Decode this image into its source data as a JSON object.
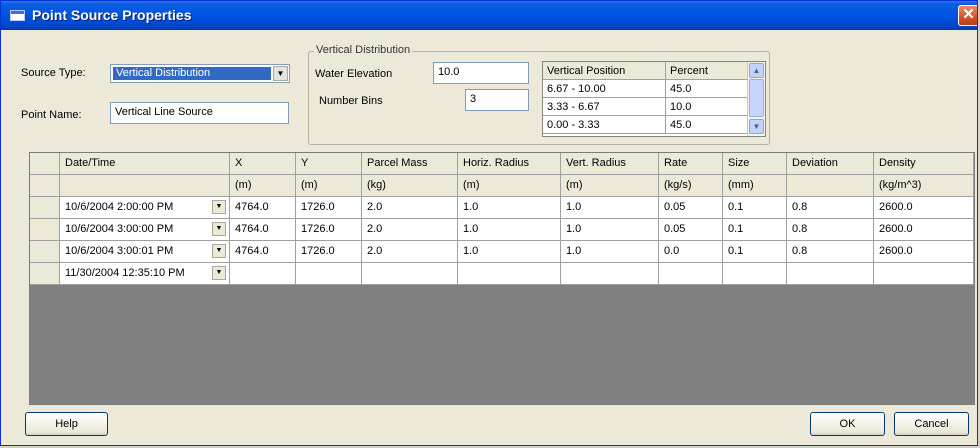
{
  "window": {
    "title": "Point Source Properties",
    "close_glyph": "✕"
  },
  "source_type": {
    "label": "Source Type:",
    "value": "Vertical Distribution"
  },
  "point_name": {
    "label": "Point Name:",
    "value": "Vertical Line Source"
  },
  "vertical_distribution": {
    "group_label": "Vertical Distribution",
    "water_elevation": {
      "label": "Water Elevation",
      "value": "10.0"
    },
    "number_bins": {
      "label": "Number Bins",
      "value": "3"
    },
    "bins_table": {
      "headers": [
        "Vertical Position",
        "Percent"
      ],
      "rows": [
        [
          "6.67 - 10.00",
          "45.0"
        ],
        [
          "3.33 - 6.67",
          "10.0"
        ],
        [
          "0.00 - 3.33",
          "45.0"
        ]
      ]
    }
  },
  "grid": {
    "columns": [
      "Date/Time",
      "X",
      "Y",
      "Parcel Mass",
      "Horiz. Radius",
      "Vert. Radius",
      "Rate",
      "Size",
      "Deviation",
      "Density"
    ],
    "units": [
      "",
      "(m)",
      "(m)",
      "(kg)",
      "(m)",
      "(m)",
      "(kg/s)",
      "(mm)",
      "",
      "(kg/m^3)"
    ],
    "rows": [
      [
        "10/6/2004 2:00:00 PM",
        "4764.0",
        "1726.0",
        "2.0",
        "1.0",
        "1.0",
        "0.05",
        "0.1",
        "0.8",
        "2600.0"
      ],
      [
        "10/6/2004 3:00:00 PM",
        "4764.0",
        "1726.0",
        "2.0",
        "1.0",
        "1.0",
        "0.05",
        "0.1",
        "0.8",
        "2600.0"
      ],
      [
        "10/6/2004 3:00:01 PM",
        "4764.0",
        "1726.0",
        "2.0",
        "1.0",
        "1.0",
        "0.0",
        "0.1",
        "0.8",
        "2600.0"
      ],
      [
        "11/30/2004 12:35:10 PM",
        "",
        "",
        "",
        "",
        "",
        "",
        "",
        "",
        ""
      ]
    ]
  },
  "buttons": {
    "help": "Help",
    "ok": "OK",
    "cancel": "Cancel"
  },
  "icons": {
    "dropdown": "chevron-down-icon",
    "scroll_up": "chevron-up-icon",
    "scroll_down": "chevron-down-icon"
  }
}
